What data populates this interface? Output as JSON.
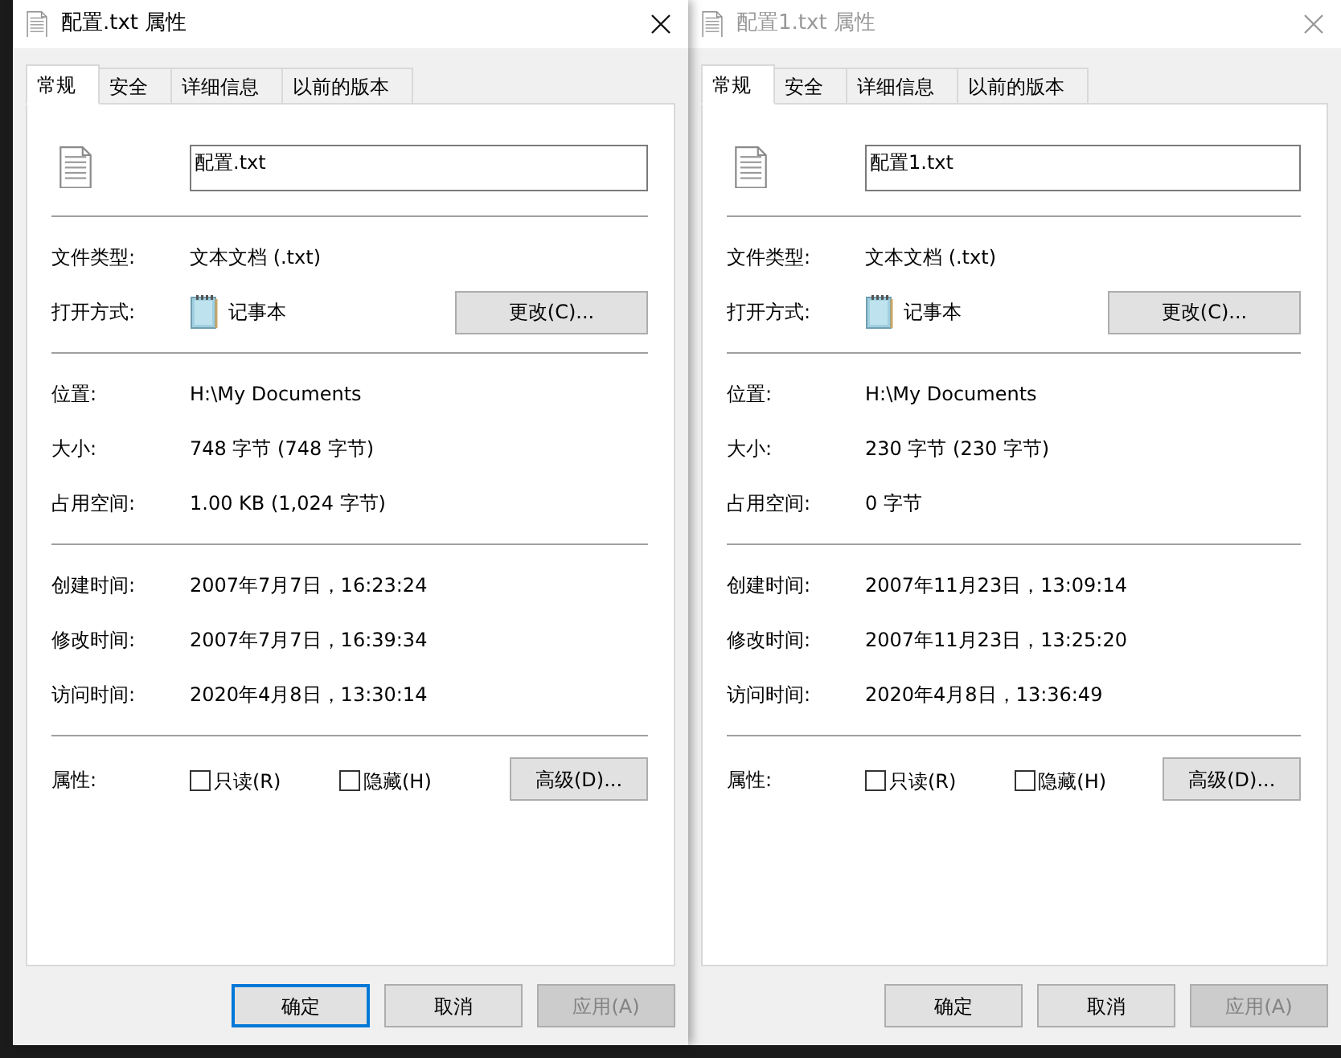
{
  "dialogs": [
    {
      "active": true,
      "title": "配置.txt 属性",
      "tabs": [
        {
          "label": "常规",
          "selected": true
        },
        {
          "label": "安全",
          "selected": false
        },
        {
          "label": "详细信息",
          "selected": false
        },
        {
          "label": "以前的版本",
          "selected": false
        }
      ],
      "filename": "配置.txt",
      "file_type": {
        "label": "文件类型:",
        "value": "文本文档 (.txt)"
      },
      "opens_with": {
        "label": "打开方式:",
        "value": "记事本",
        "button": "更改(C)..."
      },
      "location_rows": [
        {
          "label": "位置:",
          "value": "H:\\My Documents"
        },
        {
          "label": "大小:",
          "value": "748 字节 (748 字节)"
        },
        {
          "label": "占用空间:",
          "value": "1.00 KB (1,024 字节)"
        }
      ],
      "time_rows": [
        {
          "label": "创建时间:",
          "value": "2007年7月7日，16:23:24"
        },
        {
          "label": "修改时间:",
          "value": "2007年7月7日，16:39:34"
        },
        {
          "label": "访问时间:",
          "value": "2020年4月8日，13:30:14"
        }
      ],
      "attributes": {
        "label": "属性:",
        "options": [
          {
            "label": "只读(R)",
            "checked": false
          },
          {
            "label": "隐藏(H)",
            "checked": false
          }
        ],
        "button": "高级(D)..."
      },
      "buttons": [
        {
          "label": "确定",
          "focused": true,
          "disabled": false
        },
        {
          "label": "取消",
          "focused": false,
          "disabled": false
        },
        {
          "label": "应用(A)",
          "focused": false,
          "disabled": true
        }
      ]
    },
    {
      "active": false,
      "title": "配置1.txt 属性",
      "tabs": [
        {
          "label": "常规",
          "selected": true
        },
        {
          "label": "安全",
          "selected": false
        },
        {
          "label": "详细信息",
          "selected": false
        },
        {
          "label": "以前的版本",
          "selected": false
        }
      ],
      "filename": "配置1.txt",
      "file_type": {
        "label": "文件类型:",
        "value": "文本文档 (.txt)"
      },
      "opens_with": {
        "label": "打开方式:",
        "value": "记事本",
        "button": "更改(C)..."
      },
      "location_rows": [
        {
          "label": "位置:",
          "value": "H:\\My Documents"
        },
        {
          "label": "大小:",
          "value": "230 字节 (230 字节)"
        },
        {
          "label": "占用空间:",
          "value": "0 字节"
        }
      ],
      "time_rows": [
        {
          "label": "创建时间:",
          "value": "2007年11月23日，13:09:14"
        },
        {
          "label": "修改时间:",
          "value": "2007年11月23日，13:25:20"
        },
        {
          "label": "访问时间:",
          "value": "2020年4月8日，13:36:49"
        }
      ],
      "attributes": {
        "label": "属性:",
        "options": [
          {
            "label": "只读(R)",
            "checked": false
          },
          {
            "label": "隐藏(H)",
            "checked": false
          }
        ],
        "button": "高级(D)..."
      },
      "buttons": [
        {
          "label": "确定",
          "focused": false,
          "disabled": false
        },
        {
          "label": "取消",
          "focused": false,
          "disabled": false
        },
        {
          "label": "应用(A)",
          "focused": false,
          "disabled": true
        }
      ]
    }
  ]
}
